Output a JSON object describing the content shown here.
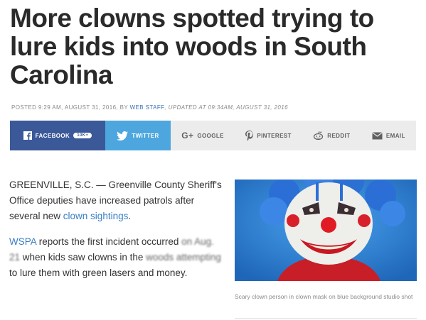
{
  "headline": "More clowns spotted trying to lure kids into woods in South Carolina",
  "meta": {
    "posted": "POSTED 9:29 AM, AUGUST 31, 2016, BY",
    "author": "WEB STAFF",
    "updated": ", UPDATED AT 09:34AM, AUGUST 31, 2016"
  },
  "share": {
    "facebook": "FACEBOOK",
    "facebook_count": "10K+",
    "twitter": "TWITTER",
    "google": "GOOGLE",
    "pinterest": "PINTEREST",
    "reddit": "REDDIT",
    "email": "EMAIL"
  },
  "article": {
    "p1_start": "GREENVILLE, S.C. — Greenville County Sheriff's Office deputies have increased patrols after several new ",
    "p1_link": "clown sightings",
    "p1_end": ".",
    "p2_link": "WSPA",
    "p2_a": " reports the first incident occurred ",
    "p2_blur1": "on Aug. 21",
    "p2_b": " when kids saw clowns in the ",
    "p2_blur2": "woods attempting",
    "p2_c": " to lure them with green lasers and money."
  },
  "photo": {
    "caption": "Scary clown person in clown mask on blue background studio shot"
  },
  "colors": {
    "facebook": "#3b5998",
    "twitter": "#4da7de",
    "link": "#3a7fc4",
    "author": "#3a6fb5",
    "photo_bg": "#2a7fd1"
  }
}
